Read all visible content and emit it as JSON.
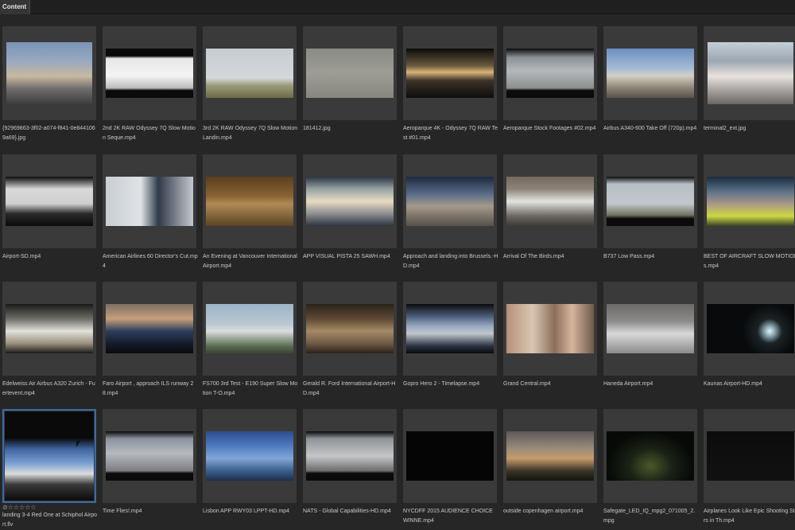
{
  "tabs": [
    {
      "label": "Content"
    }
  ],
  "items": [
    {
      "caption": "{92969863-3f02-a074-f841-0e8441069a69}.jpg",
      "thumb": "linear-gradient(180deg,#7b94b8 0%,#98a9c0 30%,#c9b7a1 55%,#6f6d6d 75%,#3c3c3c 100%)"
    },
    {
      "caption": "2nd 2K RAW Odyssey 7Q Slow Motion Seque.mp4",
      "thumb": "linear-gradient(180deg,#0b0b0b 0%,#0b0b0b 15%,#e7e7e7 20%,#f4f4f4 55%,#bcbcbc 80%,#0b0b0b 85%)"
    },
    {
      "caption": "3rd 2K RAW Odyssey 7Q Slow Motion Landin.mp4",
      "thumb": "linear-gradient(180deg,#c6ccd1 0%,#d4d8db 60%,#9a9a7a 75%,#6e6b4a 100%)"
    },
    {
      "caption": "181412.jpg",
      "thumb": "linear-gradient(180deg,#8b8b85 0%,#9d9d96 50%,#878780 100%)"
    },
    {
      "caption": "Aeroparque 4K - Odyssey 7Q RAW Test #01.mp4",
      "thumb": "linear-gradient(180deg,#0a0a0a 0%,#6b5a3e 35%,#d9b37a 48%,#3c3228 65%,#0d0d0d 100%)"
    },
    {
      "caption": "Aeroparque Stock Footages #02.mp4",
      "thumb": "linear-gradient(180deg,#0b0b0b 0%,#8b9196 18%,#b3b8bb 45%,#8d8f8f 80%,#0b0b0b 85%)"
    },
    {
      "caption": "Airbus A340-600 Take Off (720p).mp4",
      "thumb": "linear-gradient(180deg,#6c8fc1 0%,#a5bbd5 40%,#d4d0c4 55%,#8c8476 80%,#57524a 100%)"
    },
    {
      "caption": "terminal2_ext.jpg",
      "thumb": "linear-gradient(180deg,#c4cfd8 0%,#9ba7b2 30%,#e9e2dc 55%,#9f9b98 80%,#6a6663 100%)"
    },
    {
      "caption": "Airport-SD.mp4",
      "thumb": "linear-gradient(180deg,#0a0a0a 0%,#d9d9d9 25%,#cfcfcf 55%,#2a2a2a 75%,#0a0a0a 100%)"
    },
    {
      "caption": "American Airlines 60  Director's Cut.mp4",
      "thumb": "linear-gradient(90deg,#c9ced3 0%,#dfe3e6 40%,#2f3a49 60%,#c3c8cc 100%)"
    },
    {
      "caption": "An Evening at Vancouver International Airport.mp4",
      "thumb": "linear-gradient(180deg,#5a3e1e 0%,#8a6432 40%,#b08b57 55%,#5c4324 100%)"
    },
    {
      "caption": "APP VISUAL PISTA 25 SAWH.mp4",
      "thumb": "linear-gradient(180deg,#2c3340 0%,#97a2a6 25%,#e7dbc2 50%,#8d8f90 75%,#2e3540 100%)"
    },
    {
      "caption": "Approach and landing into Brussels.-HD.mp4",
      "thumb": "linear-gradient(180deg,#1e2a3f 0%,#5a6c89 35%,#a49a8a 60%,#55504a 100%)"
    },
    {
      "caption": "Arrival Of The Birds.mp4",
      "thumb": "linear-gradient(180deg,#76695e 0%,#8e8378 25%,#e3e3e1 50%,#6a6762 80%,#3c3a36 100%)"
    },
    {
      "caption": "B737 Low Pass.mp4",
      "thumb": "linear-gradient(180deg,#0b0b0b 0%,#b6bec6 15%,#c2c7cc 55%,#6f725f 78%,#0b0b0b 85%)"
    },
    {
      "caption": "BEST OF AIRCRAFT SLOW MOTIONs.mp4",
      "thumb": "linear-gradient(180deg,#1a2c3e 0%,#5c7189 30%,#a99886 55%,#cbd743 80%,#394428 100%)"
    },
    {
      "caption": "Edelweiss Air Airbus A320 Zurich - Fuertevent.mp4",
      "thumb": "linear-gradient(180deg,#1a1a1a 0%,#6d6c66 30%,#e2e1db 55%,#9a8f7d 80%,#1a1a1a 100%)"
    },
    {
      "caption": "Faro Airport , approach ILS runway 28.mp4",
      "thumb": "linear-gradient(180deg,#7b6f66 0%,#c6a07a 30%,#2d3d5c 55%,#151d2b 80%,#0a0a0a 100%)"
    },
    {
      "caption": "FS700 3rd Test - E190 Super Slow Motion T-O.mp4",
      "thumb": "linear-gradient(180deg,#9fb4c8 0%,#b9c7d2 40%,#d8dcdf 55%,#5d6e52 85%,#3a4433 100%)"
    },
    {
      "caption": "Gerald R. Ford International Airport-HD.mp4",
      "thumb": "linear-gradient(180deg,#2a221a 0%,#5e4a35 30%,#a48a66 55%,#6e5a44 80%,#2a221a 100%)"
    },
    {
      "caption": "Gopro Hero 2 - Timelapse.mp4",
      "thumb": "linear-gradient(180deg,#0a0a0a 0%,#4b5d7a 25%,#9aa9c2 45%,#c0c6cc 60%,#2b3344 85%,#0a0a0a 100%)"
    },
    {
      "caption": "Grand Central.mp4",
      "thumb": "linear-gradient(90deg,#b6907a 0%,#d9c6b2 30%,#8c6e5b 55%,#d6b59c 75%,#6e5a4c 100%)"
    },
    {
      "caption": "Haneda Airport.mp4",
      "thumb": "linear-gradient(180deg,#6c6a69 0%,#8d8b89 35%,#d9d9d9 60%,#8a8a8a 100%)"
    },
    {
      "caption": "Kaunas Airport-HD.mp4",
      "thumb": "radial-gradient(circle at 72% 55%,#e7f0f3 0%,#9ab6c1 6%,#1a2326 18%,#080a0b 40%)"
    },
    {
      "caption": "landing 3-4 Red One at Schiphol Airport.flv",
      "thumb": "linear-gradient(180deg,#0a0a0a 0%,#0a0a0a 30%,#3f63a0 42%,#7aa0d0 58%,#dcdcdc 70%,#3a3a3a 82%,#0a0a0a 100%)",
      "rating": "⊘☆☆☆☆☆"
    },
    {
      "caption": "Time Flies!.mp4",
      "thumb": "linear-gradient(180deg,#0b0b0b 0%,#8a929e 15%,#b5bac0 45%,#7c7e82 80%,#0b0b0b 85%)"
    },
    {
      "caption": "Lisbon APP RWY03 LPPT-HD.mp4",
      "thumb": "linear-gradient(180deg,#2b4d8f 0%,#4f7bc1 30%,#82a6d6 55%,#3b5f8d 80%,#1d2f50 100%)"
    },
    {
      "caption": "NATS - Global Capabilities-HD.mp4",
      "thumb": "linear-gradient(180deg,#0b0b0b 0%,#8f949a 15%,#c4c6c7 50%,#6e6e70 80%,#0b0b0b 85%)"
    },
    {
      "caption": "NYCDFF 2015 AUDIENCE CHOICE WINNE.mp4",
      "thumb": "linear-gradient(180deg,#050505 0%,#050505 100%)"
    },
    {
      "caption": "outside copenhagen airport.mp4",
      "thumb": "linear-gradient(180deg,#5d5a5a 0%,#9b8b7b 35%,#c59b6b 55%,#3d3328 80%,#151311 100%)"
    },
    {
      "caption": "Safegate_LED_IQ_mpg2_071005_2.mpg",
      "thumb": "radial-gradient(ellipse at 50% 70%,#4a5a2a 0%,#1a2216 35%,#070907 70%)"
    },
    {
      "caption": "Airplanes Look Like Epic Shooting Stars in Th.mp4",
      "thumb": "linear-gradient(180deg,#0c0c0c 0%,#111 100%)"
    }
  ]
}
